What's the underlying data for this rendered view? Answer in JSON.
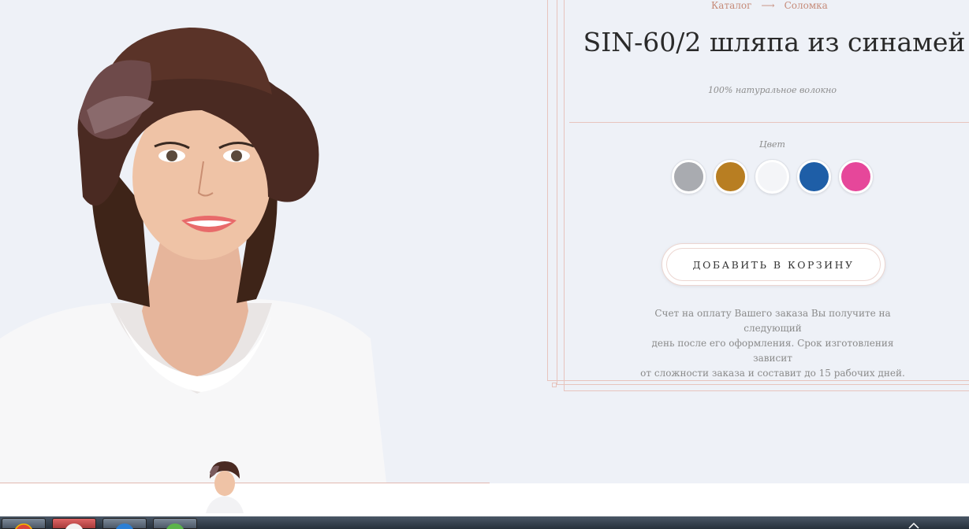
{
  "breadcrumb": {
    "catalog": "Каталог",
    "separator": "⟶",
    "current": "Соломка"
  },
  "product": {
    "title": "SIN-60/2 шляпа из синамей",
    "subtitle": "100% натуральное волокно"
  },
  "colors": {
    "label": "Цвет",
    "swatches": [
      {
        "name": "grey",
        "hex": "#a9abb0"
      },
      {
        "name": "mustard",
        "hex": "#b87e22"
      },
      {
        "name": "white",
        "hex": "#f4f5f8"
      },
      {
        "name": "blue",
        "hex": "#1e5ea7"
      },
      {
        "name": "pink",
        "hex": "#e6479a"
      }
    ]
  },
  "cart": {
    "button_label": "ДОБАВИТЬ В КОРЗИНУ"
  },
  "note": {
    "line1": "Счет на оплату Вашего заказа Вы получите на следующий",
    "line2": "день после его оформления. Срок изготовления зависит",
    "line3": "от сложности заказа и составит до 15 рабочих дней."
  },
  "theme": {
    "background": "#eef1f7",
    "accent": "#c58a78",
    "border": "#e7c4bd"
  },
  "taskbar": {
    "icons": [
      "chrome-icon",
      "app-icon",
      "ie-icon",
      "evernote-icon"
    ]
  }
}
